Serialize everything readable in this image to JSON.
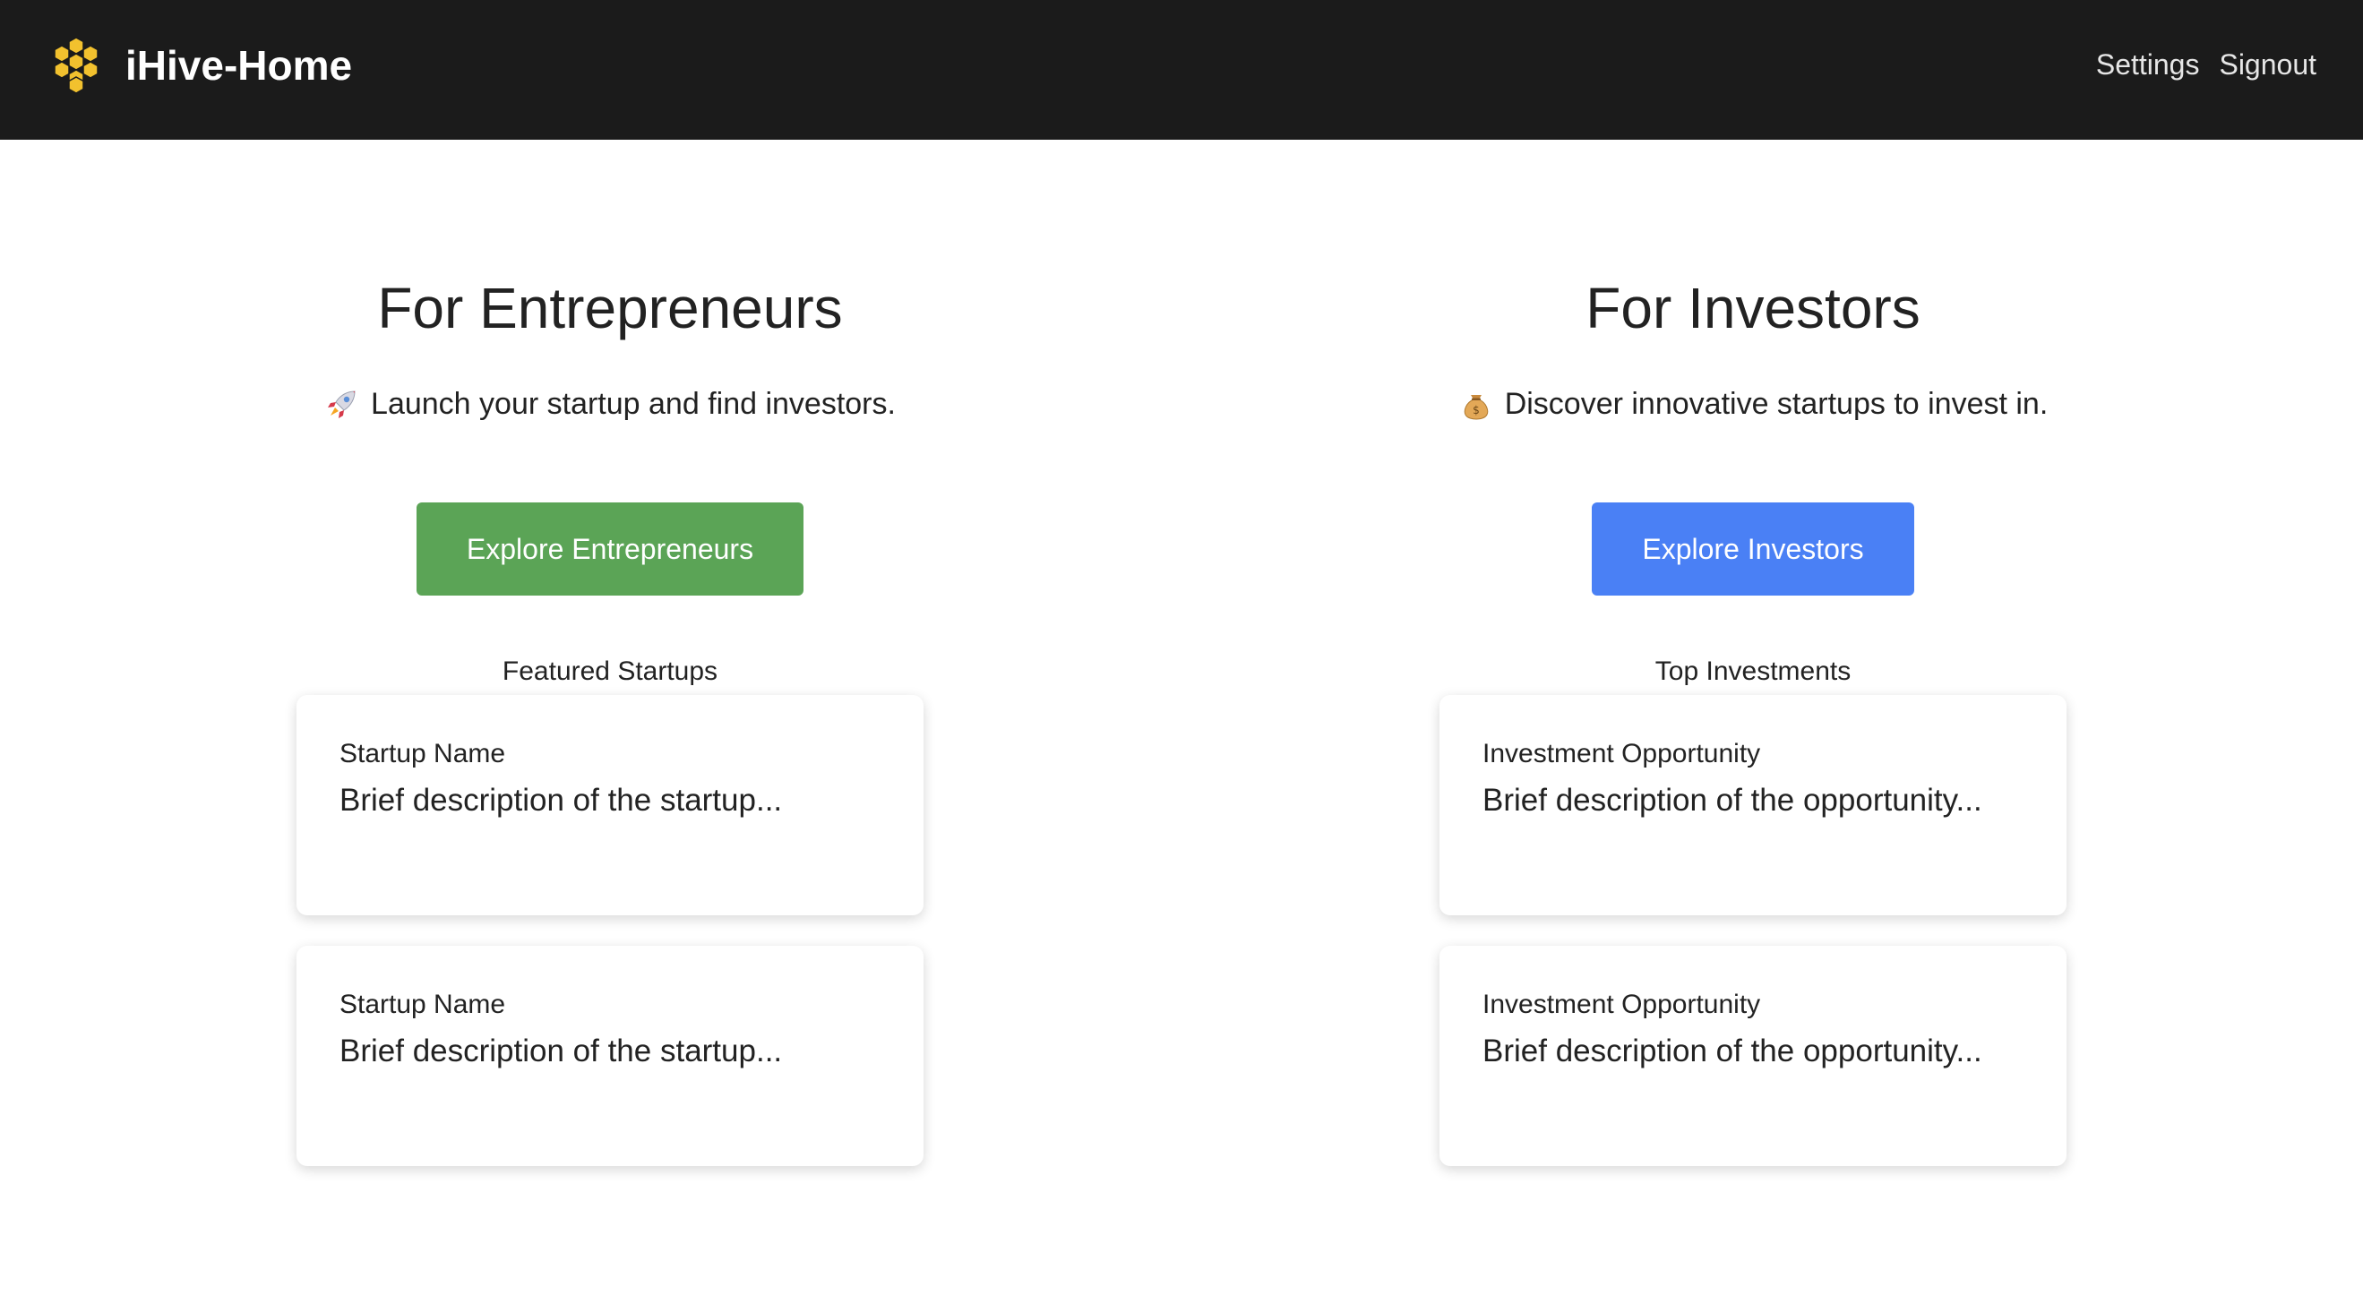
{
  "header": {
    "app_name": "iHive-Home",
    "logo_icon": "honeycomb-icon",
    "logo_color": "#f2c12e",
    "background": "#1b1b1b",
    "nav": [
      {
        "label": "Settings"
      },
      {
        "label": "Signout"
      }
    ]
  },
  "entrepreneurs": {
    "title": "For Entrepreneurs",
    "tagline_icon": "rocket-icon",
    "tagline": "Launch your startup and find investors.",
    "button_label": "Explore Entrepreneurs",
    "button_color": "#5ba456",
    "section_label": "Featured Startups",
    "cards": [
      {
        "title": "Startup Name",
        "description": "Brief description of the startup..."
      },
      {
        "title": "Startup Name",
        "description": "Brief description of the startup..."
      }
    ]
  },
  "investors": {
    "title": "For Investors",
    "tagline_icon": "money-bag-icon",
    "tagline": "Discover innovative startups to invest in.",
    "button_label": "Explore Investors",
    "button_color": "#4a80f5",
    "section_label": "Top Investments",
    "cards": [
      {
        "title": "Investment Opportunity",
        "description": "Brief description of the opportunity..."
      },
      {
        "title": "Investment Opportunity",
        "description": "Brief description of the opportunity..."
      }
    ]
  }
}
